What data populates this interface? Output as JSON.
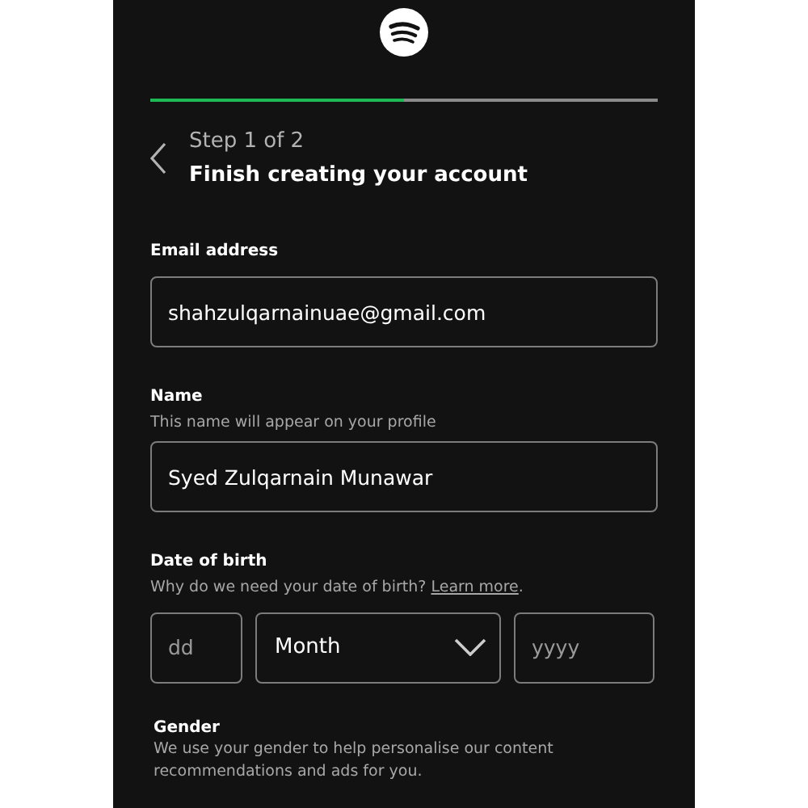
{
  "progress": {
    "level": 0.5
  },
  "header": {
    "step": "Step 1 of 2",
    "title": "Finish creating your account"
  },
  "email": {
    "label": "Email address",
    "value": "shahzulqarnainuae@gmail.com"
  },
  "name": {
    "label": "Name",
    "hint": "This name will appear on your profile",
    "value": "Syed Zulqarnain Munawar"
  },
  "birth": {
    "label": "Date of birth",
    "hint": "Why do we need your date of birth?",
    "link": "Learn more",
    "hint_end": ".",
    "day": {
      "placeholder": "dd"
    },
    "month": {
      "value": "Month"
    },
    "year": {
      "placeholder": "yyyy"
    }
  },
  "gender": {
    "label": "Gender",
    "hint": "We use your gender to help personalise our content recommendations and ads for you."
  }
}
